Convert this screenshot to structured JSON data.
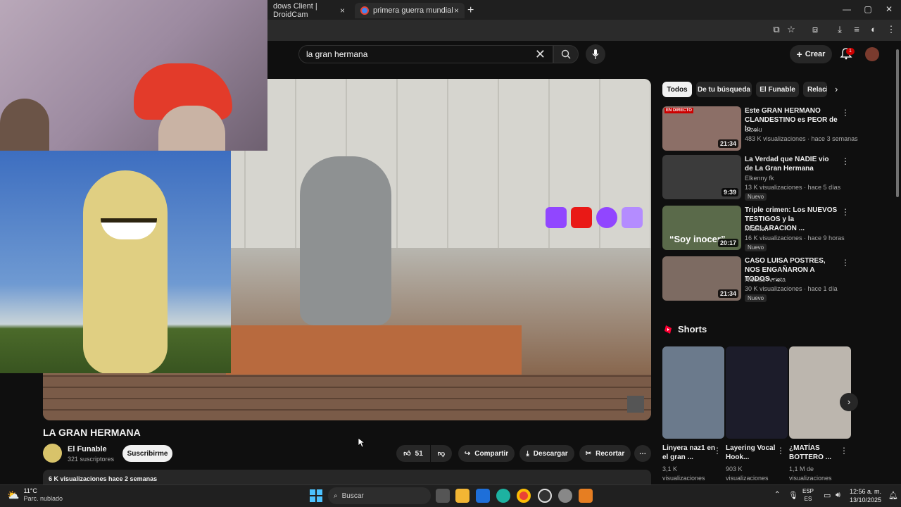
{
  "browser": {
    "tabs": [
      {
        "label": "dows Client | DroidCam",
        "close": "×"
      },
      {
        "label": "primera guerra mundial inicio -",
        "close": "×"
      }
    ],
    "new_tab": "+",
    "window_controls": [
      "—",
      "▢",
      "✕"
    ]
  },
  "header": {
    "search_value": "la gran hermana",
    "create_label": "Crear",
    "notif_count": "1"
  },
  "video": {
    "title": "LA GRAN HERMANA",
    "channel": "El Funable",
    "subscribers": "321 suscriptores",
    "subscribe_label": "Suscribirme",
    "likes": "51",
    "share_label": "Compartir",
    "download_label": "Descargar",
    "clip_label": "Recortar",
    "views_date": "6 K visualizaciones  hace 2 semanas"
  },
  "chips": [
    "Todos",
    "De tu búsqueda",
    "El Funable",
    "Relaci"
  ],
  "recommended": [
    {
      "title": "Este GRAN HERMANO CLANDESTINO es PEOR de lo ...",
      "channel": "Sizelu",
      "meta": "483 K visualizaciones · hace 3 semanas",
      "duration": "21:34",
      "badge": "",
      "live_tag": "EN DIRECTO",
      "color": "#8c6f67"
    },
    {
      "title": "La Verdad que NADIE vio de La Gran Hermana",
      "channel": "Elkenny fk",
      "meta": "13 K visualizaciones · hace 5 días",
      "duration": "9:39",
      "badge": "Nuevo",
      "live_tag": "",
      "color": "#3b3b3b"
    },
    {
      "title": "Triple crimen: Los NUEVOS TESTIGOS y la DECLARACION ...",
      "channel": "xVaRion",
      "meta": "16 K visualizaciones · hace 9 horas",
      "duration": "20:17",
      "badge": "Nuevo",
      "live_tag": "",
      "color": "#5a6a4a",
      "thumb_text": "“Soy inocer”"
    },
    {
      "title": "CASO LUISA POSTRES, NOS ENGAÑARON A TODOS  - ...",
      "channel": "Nicolas Arrieta",
      "meta": "30 K visualizaciones · hace 1 día",
      "duration": "21:34",
      "badge": "Nuevo",
      "live_tag": "",
      "color": "#7d6b62"
    }
  ],
  "shorts": {
    "heading": "Shorts",
    "items": [
      {
        "title": "Linyera naz1 en el gran ...",
        "views": "3,1 K visualizaciones",
        "color": "#6b7a8c"
      },
      {
        "title": "Layering Vocal Hook...",
        "views": "903 K visualizaciones",
        "color": "#1c1c2a"
      },
      {
        "title": "¿MATÍAS BOTTERO ...",
        "views": "1,1 M de visualizaciones",
        "color": "#bcb6ae"
      }
    ]
  },
  "taskbar": {
    "search_label": "Buscar",
    "temp": "11°C",
    "weather": "Parc. nublado",
    "lang_top": "ESP",
    "lang_bottom": "ES",
    "time": "12:56 a. m.",
    "date": "13/10/2025"
  },
  "colors": {
    "accent_red": "#cc0000",
    "bg": "#0f0f0f",
    "chip": "#272727"
  }
}
